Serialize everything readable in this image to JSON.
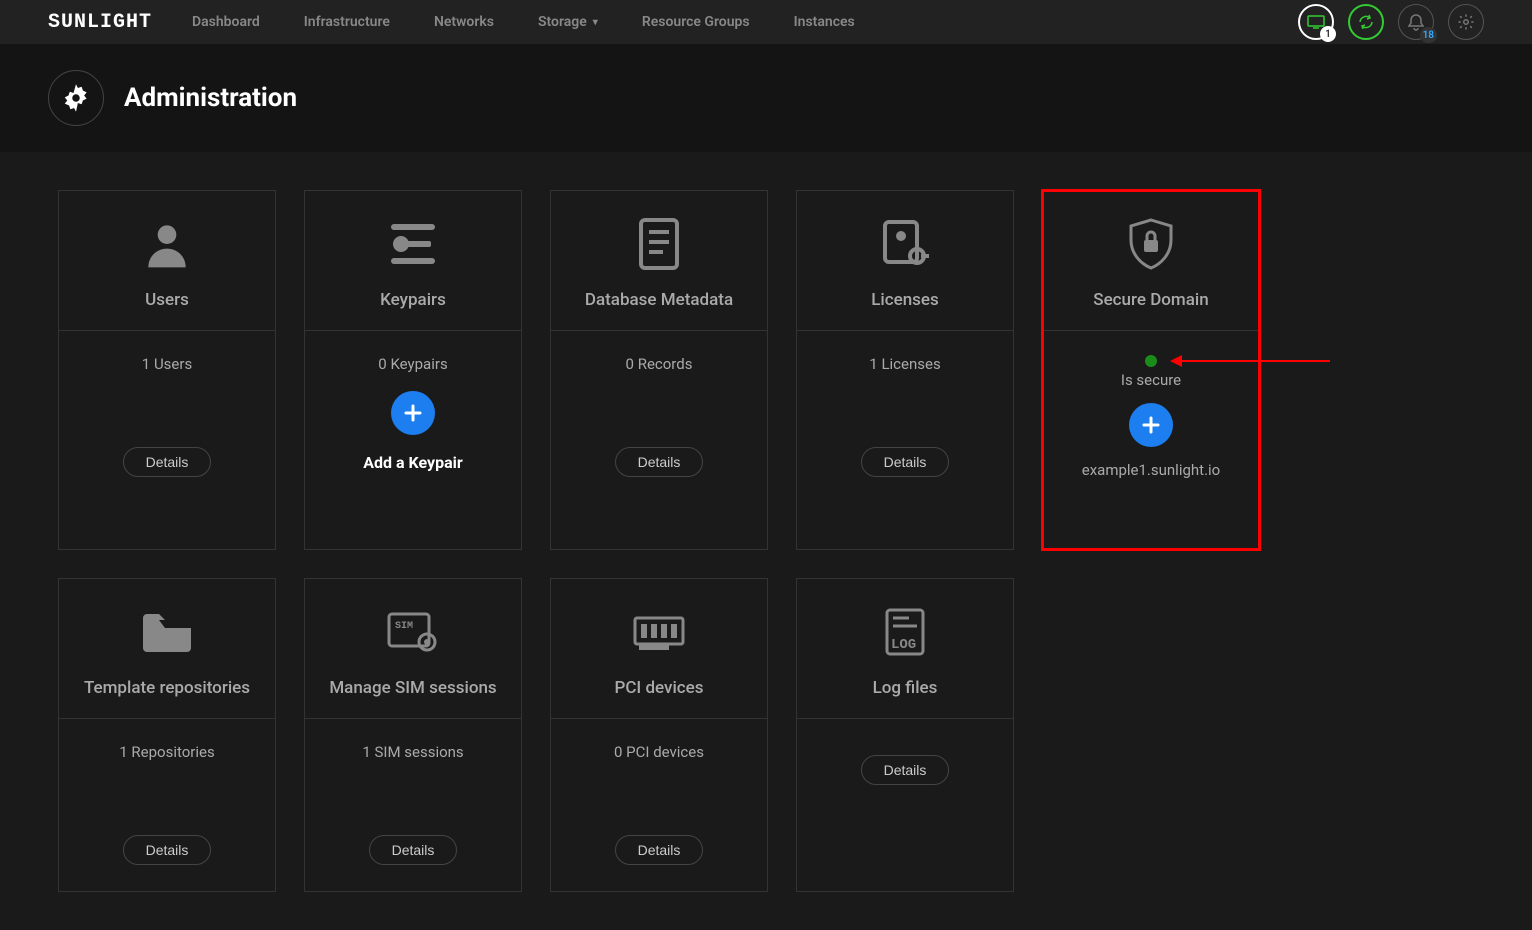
{
  "logo": "SUNLIGHT",
  "nav": {
    "items": [
      "Dashboard",
      "Infrastructure",
      "Networks",
      "Storage",
      "Resource Groups",
      "Instances"
    ],
    "dropdown_index": 3
  },
  "topright": {
    "badge1": "1",
    "badge_bell": "18"
  },
  "page": {
    "title": "Administration"
  },
  "cards": [
    {
      "title": "Users",
      "stat": "1 Users",
      "details": "Details"
    },
    {
      "title": "Keypairs",
      "stat": "0 Keypairs",
      "action": "Add a Keypair"
    },
    {
      "title": "Database Metadata",
      "stat": "0 Records",
      "details": "Details"
    },
    {
      "title": "Licenses",
      "stat": "1 Licenses",
      "details": "Details"
    },
    {
      "title": "Secure Domain",
      "status": "Is secure",
      "domain": "example1.sunlight.io"
    },
    {
      "title": "Template repositories",
      "stat": "1 Repositories",
      "details": "Details"
    },
    {
      "title": "Manage SIM sessions",
      "stat": "1 SIM sessions",
      "details": "Details"
    },
    {
      "title": "PCI devices",
      "stat": "0 PCI devices",
      "details": "Details"
    },
    {
      "title": "Log files",
      "details": "Details"
    }
  ]
}
